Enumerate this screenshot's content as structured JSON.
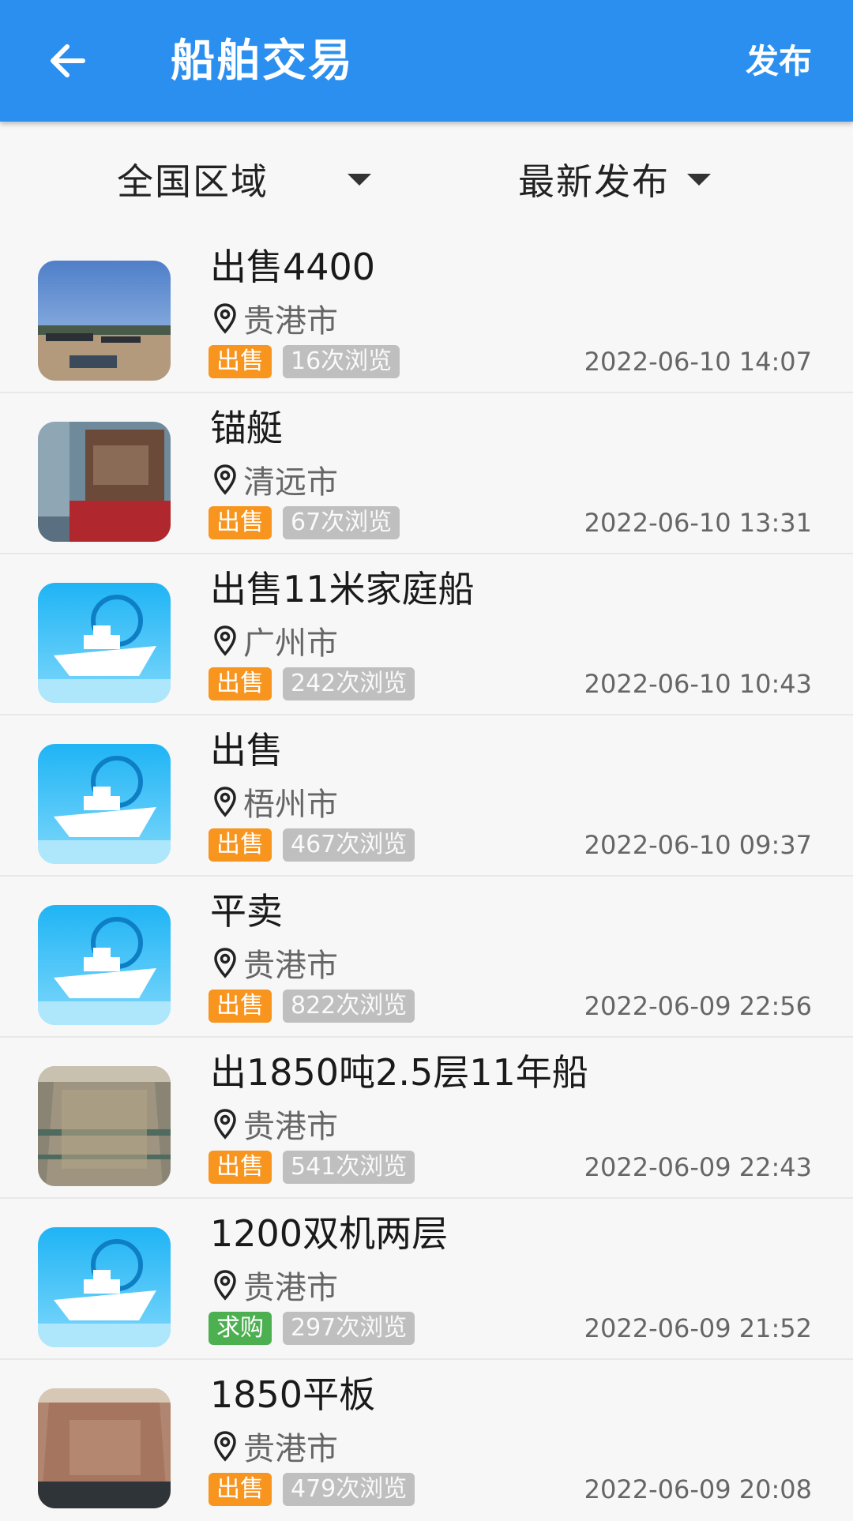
{
  "header": {
    "title": "船舶交易",
    "publish_label": "发布",
    "back_icon": "arrow-left-icon",
    "color": "#2b8ff0"
  },
  "filters": {
    "region": "全国区域",
    "sort": "最新发布"
  },
  "listings": [
    {
      "title": "出售4400",
      "location": "贵港市",
      "tag": "出售",
      "tag_type": "sell",
      "views": "16次浏览",
      "time": "2022-06-10 14:07",
      "thumb": "photo-river"
    },
    {
      "title": "锚艇",
      "location": "清远市",
      "tag": "出售",
      "tag_type": "sell",
      "views": "67次浏览",
      "time": "2022-06-10 13:31",
      "thumb": "photo-engine"
    },
    {
      "title": "出售11米家庭船",
      "location": "广州市",
      "tag": "出售",
      "tag_type": "sell",
      "views": "242次浏览",
      "time": "2022-06-10 10:43",
      "thumb": "ship-placeholder-icon"
    },
    {
      "title": "出售",
      "location": "梧州市",
      "tag": "出售",
      "tag_type": "sell",
      "views": "467次浏览",
      "time": "2022-06-10 09:37",
      "thumb": "ship-placeholder-icon"
    },
    {
      "title": "平卖",
      "location": "贵港市",
      "tag": "出售",
      "tag_type": "sell",
      "views": "822次浏览",
      "time": "2022-06-09 22:56",
      "thumb": "ship-placeholder-icon"
    },
    {
      "title": "出1850吨2.5层11年船",
      "location": "贵港市",
      "tag": "出售",
      "tag_type": "sell",
      "views": "541次浏览",
      "time": "2022-06-09 22:43",
      "thumb": "photo-hold"
    },
    {
      "title": "1200双机两层",
      "location": "贵港市",
      "tag": "求购",
      "tag_type": "buy",
      "views": "297次浏览",
      "time": "2022-06-09 21:52",
      "thumb": "ship-placeholder-icon"
    },
    {
      "title": "1850平板",
      "location": "贵港市",
      "tag": "出售",
      "tag_type": "sell",
      "views": "479次浏览",
      "time": "2022-06-09 20:08",
      "thumb": "photo-deck"
    }
  ],
  "colors": {
    "sell": "#f7951e",
    "buy": "#4caf50",
    "views": "#bfbfbf"
  }
}
